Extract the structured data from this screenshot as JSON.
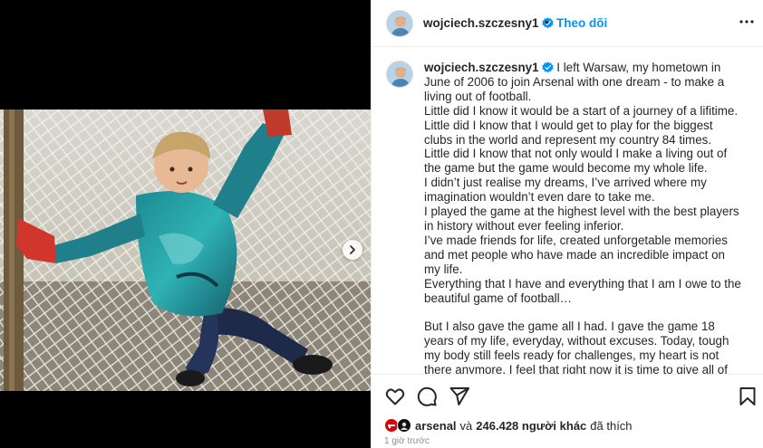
{
  "media": {
    "next_icon": "chevron-right-icon"
  },
  "header": {
    "username": "wojciech.szczesny1",
    "separator": "•",
    "follow_label": "Theo dõi",
    "more_icon": "more-horizontal-icon",
    "verified_icon": "verified-badge-icon"
  },
  "caption": {
    "username": "wojciech.szczesny1",
    "lines": [
      "I left Warsaw, my hometown in June of 2006 to join Arsenal with one dream - to make a living out of football.",
      "Little did I know it would be a start of a journey of a lifitime.",
      "Little did I know that I would get to play for the biggest clubs in the world and represent my country 84 times.",
      "Little did I know that not only would I make a living out of the game but the game would become my whole life.",
      "I didn’t just realise my dreams, I’ve arrived where my imagination wouldn’t even dare to take me.",
      "I played the game at the highest level with the best players in history without ever feeling inferior.",
      "I’ve made friends for life, created unforgetable memories and met people who have made an incredible impact on my life.",
      "Everything that I have and everything that I am I owe to the beautiful game of football…",
      "But I also gave the game all I had. I gave the game 18 years of my life, everyday, without excuses. Today, tough my body still feels ready for challenges, my heart is not there anymore. I feel that right now it is time to give all of my attention to my family - my amazing wife Marina and our two beautiful"
    ]
  },
  "actions": {
    "like_icon": "heart-icon",
    "comment_icon": "comment-icon",
    "share_icon": "send-icon",
    "save_icon": "bookmark-icon"
  },
  "likes": {
    "first_user": "arsenal",
    "conjunction": "và",
    "count": "246.428 người khác",
    "suffix": "đã thích"
  },
  "timestamp": "1 giờ trước",
  "colors": {
    "link_blue": "#0095f6",
    "verified_blue": "#0095f6",
    "arsenal_red": "#db0007"
  }
}
